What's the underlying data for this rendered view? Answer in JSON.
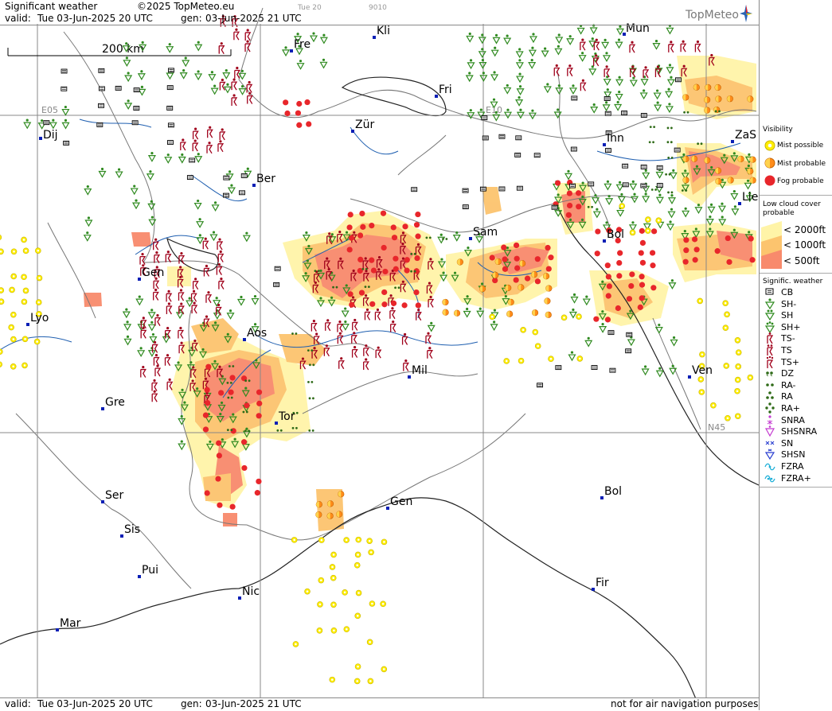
{
  "header": {
    "product_title": "Significant weather",
    "copyright": "©2025 TopMeteo.eu",
    "day_code": "Tue 20",
    "code": "9010",
    "valid_label": "valid:",
    "valid_value": "Tue  03-Jun-2025  20 UTC",
    "gen_label": "gen:",
    "gen_value": "03-Jun-2025 21 UTC",
    "logo": "TopMeteo"
  },
  "footer": {
    "valid_label": "valid:",
    "valid_value": "Tue  03-Jun-2025  20 UTC",
    "gen_label": "gen:",
    "gen_value": "03-Jun-2025 21 UTC",
    "disclaimer": "not for air navigation purposes"
  },
  "scale": {
    "label": "200 km"
  },
  "grid_labels": {
    "e05": "E05",
    "e10": "E10",
    "n45": "N45"
  },
  "cities": [
    "Mun",
    "Kli",
    "Fre",
    "Fri",
    "Zür",
    "Dij",
    "Ber",
    "Inn",
    "ZaS",
    "Lie",
    "Sam",
    "Bol",
    "Gen",
    "Lyo",
    "Aos",
    "Mil",
    "Ven",
    "Gre",
    "Tor",
    "Gen",
    "Bol",
    "Ser",
    "Sis",
    "Pui",
    "Nic",
    "Fir",
    "Mar"
  ],
  "legend": {
    "visibility": {
      "title": "Visibility",
      "items": [
        {
          "label": "Mist possible",
          "color": "#ffee00"
        },
        {
          "label": "Mist probable",
          "color": "#ff8c1a"
        },
        {
          "label": "Fog probable",
          "color": "#e8262b"
        }
      ]
    },
    "low_cloud": {
      "title_line1": "Low cloud cover",
      "title_line2": "probable",
      "items": [
        {
          "label": "< 2000ft",
          "color": "#fff4a8"
        },
        {
          "label": "< 1000ft",
          "color": "#fcc46e"
        },
        {
          "label": "<   500ft",
          "color": "#f88a6c"
        }
      ]
    },
    "signific": {
      "title": "Signific. weather",
      "items": [
        {
          "label": "CB",
          "icon": "cb-icon"
        },
        {
          "label": "SH-",
          "icon": "shower-light-icon"
        },
        {
          "label": "SH",
          "icon": "shower-icon"
        },
        {
          "label": "SH+",
          "icon": "shower-heavy-icon"
        },
        {
          "label": "TS-",
          "icon": "thunderstorm-light-icon"
        },
        {
          "label": "TS",
          "icon": "thunderstorm-icon"
        },
        {
          "label": "TS+",
          "icon": "thunderstorm-heavy-icon"
        },
        {
          "label": "DZ",
          "icon": "drizzle-icon"
        },
        {
          "label": "RA-",
          "icon": "rain-light-icon"
        },
        {
          "label": "RA",
          "icon": "rain-icon"
        },
        {
          "label": "RA+",
          "icon": "rain-heavy-icon"
        },
        {
          "label": "SNRA",
          "icon": "snow-rain-icon"
        },
        {
          "label": "SHSNRA",
          "icon": "snow-rain-shower-icon"
        },
        {
          "label": "SN",
          "icon": "snow-icon"
        },
        {
          "label": "SHSN",
          "icon": "snow-shower-icon"
        },
        {
          "label": "FZRA",
          "icon": "freezing-rain-icon"
        },
        {
          "label": "FZRA+",
          "icon": "freezing-rain-heavy-icon"
        }
      ]
    }
  },
  "colors": {
    "fog": "#e8262b",
    "mist_probable": "#ff8c1a",
    "mist_possible": "#ffee00",
    "cloud_2000": "#fff4a8",
    "cloud_1000": "#fcc46e",
    "cloud_500": "#f88a6c",
    "shower": "#2f8a1f",
    "thunder": "#a0001b",
    "water": "#1f5fb0"
  }
}
